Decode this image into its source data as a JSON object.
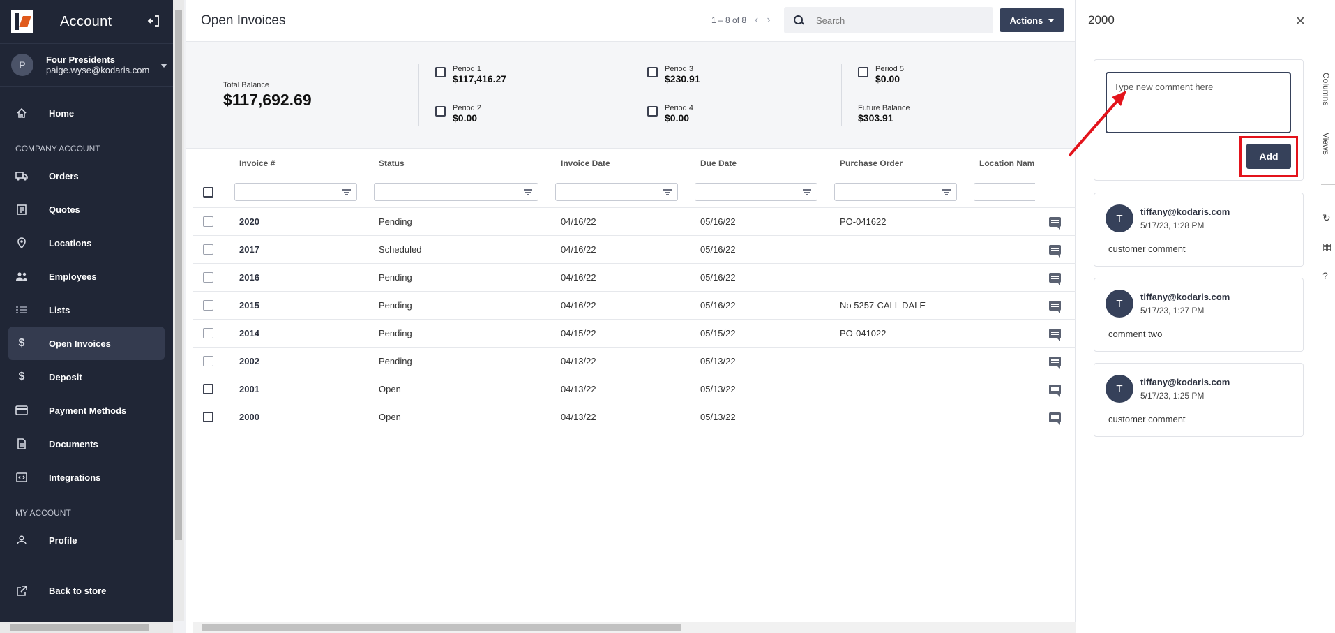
{
  "sidebar": {
    "title": "Account",
    "user": {
      "initial": "P",
      "company": "Four Presidents",
      "email": "paige.wyse@kodaris.com"
    },
    "items_top": [
      {
        "label": "Home",
        "icon": "home-icon"
      }
    ],
    "company_section": "COMPANY ACCOUNT",
    "company_items": [
      {
        "label": "Orders",
        "icon": "truck-icon"
      },
      {
        "label": "Quotes",
        "icon": "clipboard-icon"
      },
      {
        "label": "Locations",
        "icon": "map-pin-icon"
      },
      {
        "label": "Employees",
        "icon": "people-icon"
      },
      {
        "label": "Lists",
        "icon": "list-icon"
      },
      {
        "label": "Open Invoices",
        "icon": "dollar-icon",
        "active": true
      },
      {
        "label": "Deposit",
        "icon": "dollar-icon"
      },
      {
        "label": "Payment Methods",
        "icon": "credit-card-icon"
      },
      {
        "label": "Documents",
        "icon": "document-icon"
      },
      {
        "label": "Integrations",
        "icon": "integration-icon"
      }
    ],
    "my_section": "MY ACCOUNT",
    "my_items": [
      {
        "label": "Profile",
        "icon": "person-icon"
      }
    ],
    "footer": {
      "label": "Back to store",
      "icon": "external-link-icon"
    }
  },
  "main": {
    "title": "Open Invoices",
    "pager": "1 – 8 of 8",
    "search_placeholder": "Search",
    "actions_label": "Actions",
    "summary": {
      "total_label": "Total Balance",
      "total_value": "$117,692.69",
      "periods": [
        {
          "label": "Period 1",
          "value": "$117,416.27"
        },
        {
          "label": "Period 2",
          "value": "$0.00"
        },
        {
          "label": "Period 3",
          "value": "$230.91"
        },
        {
          "label": "Period 4",
          "value": "$0.00"
        },
        {
          "label": "Period 5",
          "value": "$0.00"
        },
        {
          "label": "Future Balance",
          "value": "$303.91"
        }
      ]
    },
    "table": {
      "columns": [
        "Invoice #",
        "Status",
        "Invoice Date",
        "Due Date",
        "Purchase Order",
        "Location Nam"
      ],
      "rows": [
        {
          "invoice": "2020",
          "status": "Pending",
          "invoice_date": "04/16/22",
          "due_date": "05/16/22",
          "po": "PO-041622"
        },
        {
          "invoice": "2017",
          "status": "Scheduled",
          "invoice_date": "04/16/22",
          "due_date": "05/16/22",
          "po": ""
        },
        {
          "invoice": "2016",
          "status": "Pending",
          "invoice_date": "04/16/22",
          "due_date": "05/16/22",
          "po": ""
        },
        {
          "invoice": "2015",
          "status": "Pending",
          "invoice_date": "04/16/22",
          "due_date": "05/16/22",
          "po": "No 5257-CALL DALE"
        },
        {
          "invoice": "2014",
          "status": "Pending",
          "invoice_date": "04/15/22",
          "due_date": "05/15/22",
          "po": "PO-041022"
        },
        {
          "invoice": "2002",
          "status": "Pending",
          "invoice_date": "04/13/22",
          "due_date": "05/13/22",
          "po": ""
        },
        {
          "invoice": "2001",
          "status": "Open",
          "invoice_date": "04/13/22",
          "due_date": "05/13/22",
          "po": ""
        },
        {
          "invoice": "2000",
          "status": "Open",
          "invoice_date": "04/13/22",
          "due_date": "05/13/22",
          "po": ""
        }
      ]
    }
  },
  "panel": {
    "title": "2000",
    "composer_placeholder": "Type new comment here",
    "add_label": "Add",
    "comments": [
      {
        "initial": "T",
        "user": "tiffany@kodaris.com",
        "time": "5/17/23, 1:28 PM",
        "text": "customer comment"
      },
      {
        "initial": "T",
        "user": "tiffany@kodaris.com",
        "time": "5/17/23, 1:27 PM",
        "text": "comment two"
      },
      {
        "initial": "T",
        "user": "tiffany@kodaris.com",
        "time": "5/17/23, 1:25 PM",
        "text": "customer comment"
      }
    ],
    "rail": {
      "columns": "Columns",
      "views": "Views"
    }
  },
  "colors": {
    "sidebar_bg": "#202636",
    "accent": "#36415a",
    "highlight": "#e3131b",
    "brand_orange": "#e05a1c"
  }
}
